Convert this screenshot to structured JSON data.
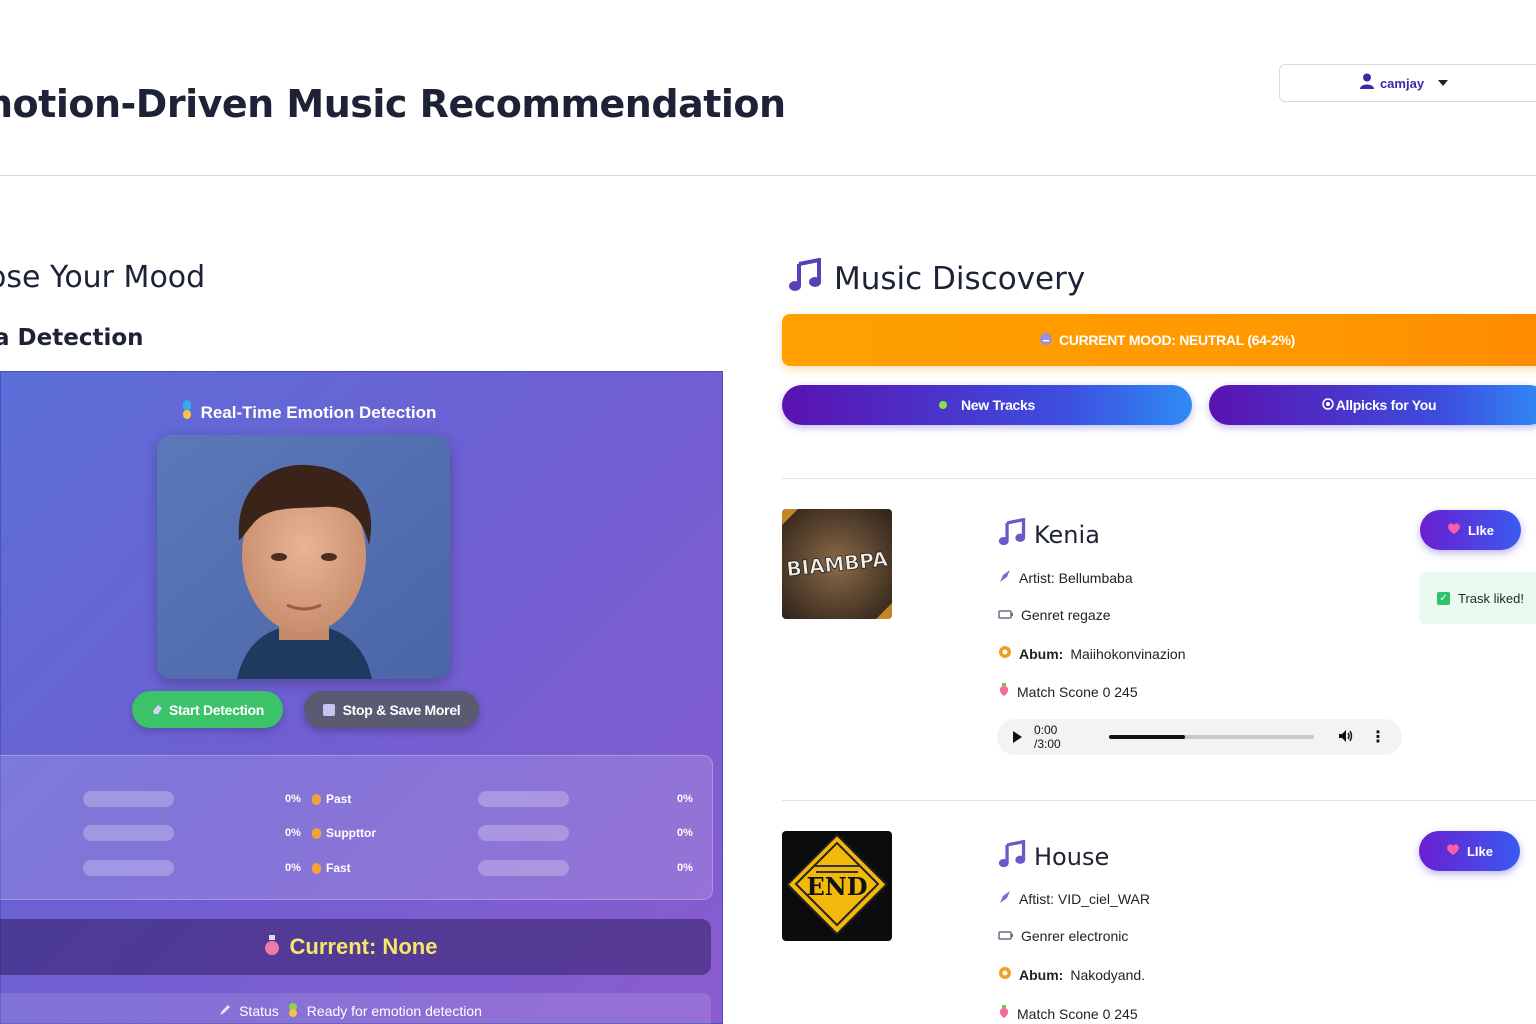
{
  "header": {
    "title": "notion-Driven Music Recommendation",
    "user": {
      "name": "camjay"
    }
  },
  "left": {
    "mood_heading": "ose Your Mood",
    "detection_heading": "a Detection",
    "camera": {
      "title": "Real-Time Emotion Detection",
      "start_label": "Start Detection",
      "stop_label": "Stop & Save Morel"
    },
    "emotions": [
      {
        "name": "",
        "pct": "0%",
        "value": 0
      },
      {
        "name": "Past",
        "pct": "0%",
        "value": 0
      },
      {
        "name": "",
        "pct": "0%",
        "value": 0
      },
      {
        "name": "Suppttor",
        "pct": "0%",
        "value": 0
      },
      {
        "name": "",
        "pct": "0%",
        "value": 0
      },
      {
        "name": "Fast",
        "pct": "0%",
        "value": 0
      }
    ],
    "emotion_pcts_right": [
      "0%",
      "0%",
      "0%"
    ],
    "current": "Current: None",
    "status": {
      "label": "Status",
      "text": "Ready for emotion detection"
    }
  },
  "right": {
    "heading": "Music Discovery",
    "mood_banner": "CURRENT MOOD: NEUTRAL (64-2%)",
    "tabs": {
      "new": "New Tracks",
      "picks": "Allpicks for You"
    },
    "tracks": [
      {
        "title": "Kenia",
        "cover_text": "BIAMBPA",
        "artist": "Artist: Bellumbaba",
        "genre": "Genret regaze",
        "album_label": "Abum:",
        "album": "Maiihokonvinazion",
        "match": "Match Scone 0 245",
        "like": "LIke",
        "toast": "Trask liked!",
        "player": {
          "time": "0:00 /3:00",
          "progress": 0.37
        }
      },
      {
        "title": "House",
        "cover_text": "END",
        "artist": "Aftist: VID_ciel_WAR",
        "genre": "Genrer electronic",
        "album_label": "Abum:",
        "album": "Nakodyand.",
        "match": "Match Scone 0 245",
        "like": "LIke"
      }
    ]
  },
  "colors": {
    "accent_orange": "#ff9800",
    "accent_purple": "#5a12b0",
    "accent_blue": "#2f8cf5",
    "start_green": "#3cc36a",
    "current_yellow": "#f6e66a"
  }
}
